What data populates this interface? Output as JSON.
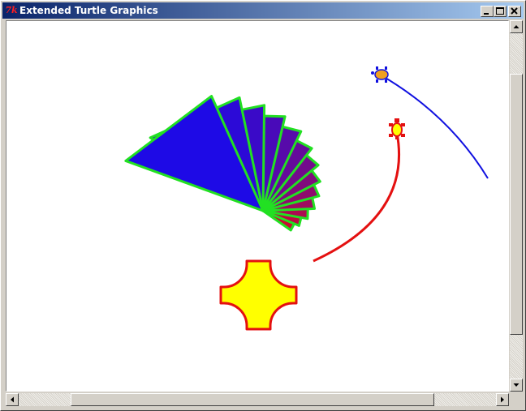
{
  "window": {
    "title": "Extended Turtle Graphics",
    "app_icon": "tk-icon",
    "app_icon_text": "7k"
  },
  "title_buttons": [
    {
      "name": "minimize-button",
      "icon": "minimize-icon"
    },
    {
      "name": "maximize-button",
      "icon": "maximize-icon"
    },
    {
      "name": "close-button",
      "icon": "close-icon"
    }
  ],
  "canvas": {
    "background": "#ffffff",
    "fan_shape": {
      "fill_start": "#1e0ae6",
      "fill_end": "#c80a32",
      "outline": "#22e022",
      "triangle_count": 13
    },
    "cross_shape": {
      "fill": "#ffff00",
      "outline": "#e41010"
    },
    "blue_turtle": {
      "fill": "#f0a020",
      "outline": "#1010e0",
      "trail": "#1010e0"
    },
    "red_turtle": {
      "fill": "#ffff00",
      "outline": "#e41010",
      "trail": "#e41010"
    }
  },
  "scrollbars": {
    "vertical": {
      "up_icon": "arrow-up-icon",
      "down_icon": "arrow-down-icon"
    },
    "horizontal": {
      "left_icon": "arrow-left-icon",
      "right_icon": "arrow-right-icon"
    }
  }
}
